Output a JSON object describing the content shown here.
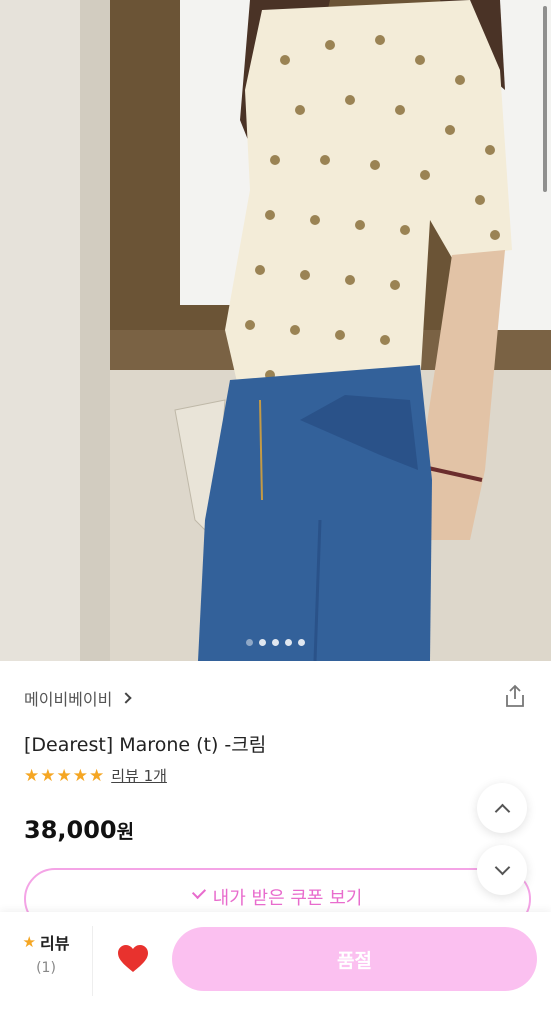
{
  "gallery": {
    "page_count": 5,
    "active_index": 0
  },
  "product": {
    "brand": "메이비베이비",
    "title": "[Dearest] Marone (t) -크림",
    "rating_stars": "★★★★★",
    "rating_value": 5,
    "review_link": "리뷰 1개",
    "price": "38,000",
    "price_unit": "원"
  },
  "coupon": {
    "label": "내가 받은 쿠폰 보기"
  },
  "bottom_bar": {
    "review_label": "리뷰",
    "review_count": "(1)",
    "soldout_label": "품절"
  },
  "colors": {
    "accent_pink": "#f4a4e6",
    "soldout_bg": "#fbc0f0",
    "star": "#f5a623",
    "heart": "#e8322e"
  }
}
